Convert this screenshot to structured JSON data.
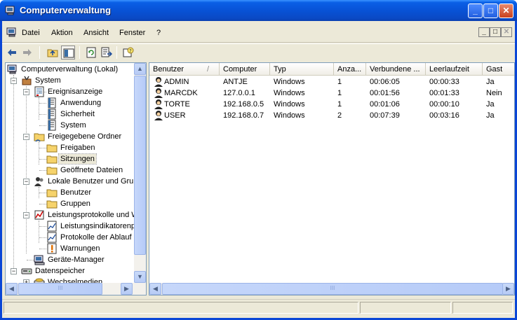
{
  "window": {
    "title": "Computerverwaltung",
    "controls": {
      "minimize": "_",
      "maximize": "□",
      "close": "✕"
    }
  },
  "menubar": {
    "items": [
      "Datei",
      "Aktion",
      "Ansicht",
      "Fenster",
      "?"
    ]
  },
  "toolbar": {
    "buttons": [
      "back-arrow-icon",
      "forward-arrow-icon",
      "up-folder-icon",
      "show-hide-tree-icon",
      "refresh-icon",
      "export-list-icon",
      "help-icon"
    ]
  },
  "tree": {
    "items": [
      {
        "label": "Computerverwaltung (Lokal)",
        "icon": "computer-management-icon"
      },
      {
        "label": "System",
        "icon": "system-tools-icon"
      },
      {
        "label": "Ereignisanzeige",
        "icon": "event-viewer-icon"
      },
      {
        "label": "Anwendung",
        "icon": "event-log-icon"
      },
      {
        "label": "Sicherheit",
        "icon": "event-log-icon"
      },
      {
        "label": "System",
        "icon": "event-log-icon"
      },
      {
        "label": "Freigegebene Ordner",
        "icon": "shared-folders-icon"
      },
      {
        "label": "Freigaben",
        "icon": "folder-icon"
      },
      {
        "label": "Sitzungen",
        "icon": "folder-icon"
      },
      {
        "label": "Geöffnete Dateien",
        "icon": "folder-icon"
      },
      {
        "label": "Lokale Benutzer und Grup",
        "icon": "local-users-icon"
      },
      {
        "label": "Benutzer",
        "icon": "folder-icon"
      },
      {
        "label": "Gruppen",
        "icon": "folder-icon"
      },
      {
        "label": "Leistungsprotokolle und W",
        "icon": "performance-logs-icon"
      },
      {
        "label": "Leistungsindikatorenp",
        "icon": "chart-log-icon"
      },
      {
        "label": "Protokolle der Ablauf",
        "icon": "chart-log-icon"
      },
      {
        "label": "Warnungen",
        "icon": "alert-icon"
      },
      {
        "label": "Geräte-Manager",
        "icon": "device-manager-icon"
      },
      {
        "label": "Datenspeicher",
        "icon": "storage-icon"
      },
      {
        "label": "Wechselmedien",
        "icon": "removable-storage-icon"
      }
    ],
    "selected": "Sitzungen",
    "hscroll_label": "III"
  },
  "list": {
    "columns": [
      "Benutzer",
      "Computer",
      "Typ",
      "Anza...",
      "Verbundene ...",
      "Leerlaufzeit",
      "Gast"
    ],
    "sort_indicator": "/",
    "rows": [
      [
        "ADMIN",
        "ANTJE",
        "Windows",
        "1",
        "00:06:05",
        "00:00:33",
        "Ja"
      ],
      [
        "MARCDK",
        "127.0.0.1",
        "Windows",
        "1",
        "00:01:56",
        "00:01:33",
        "Nein"
      ],
      [
        "TORTE",
        "192.168.0.5",
        "Windows",
        "1",
        "00:01:06",
        "00:00:10",
        "Ja"
      ],
      [
        "USER",
        "192.168.0.7",
        "Windows",
        "2",
        "00:07:39",
        "00:03:16",
        "Ja"
      ]
    ],
    "hscroll_label": "III"
  }
}
